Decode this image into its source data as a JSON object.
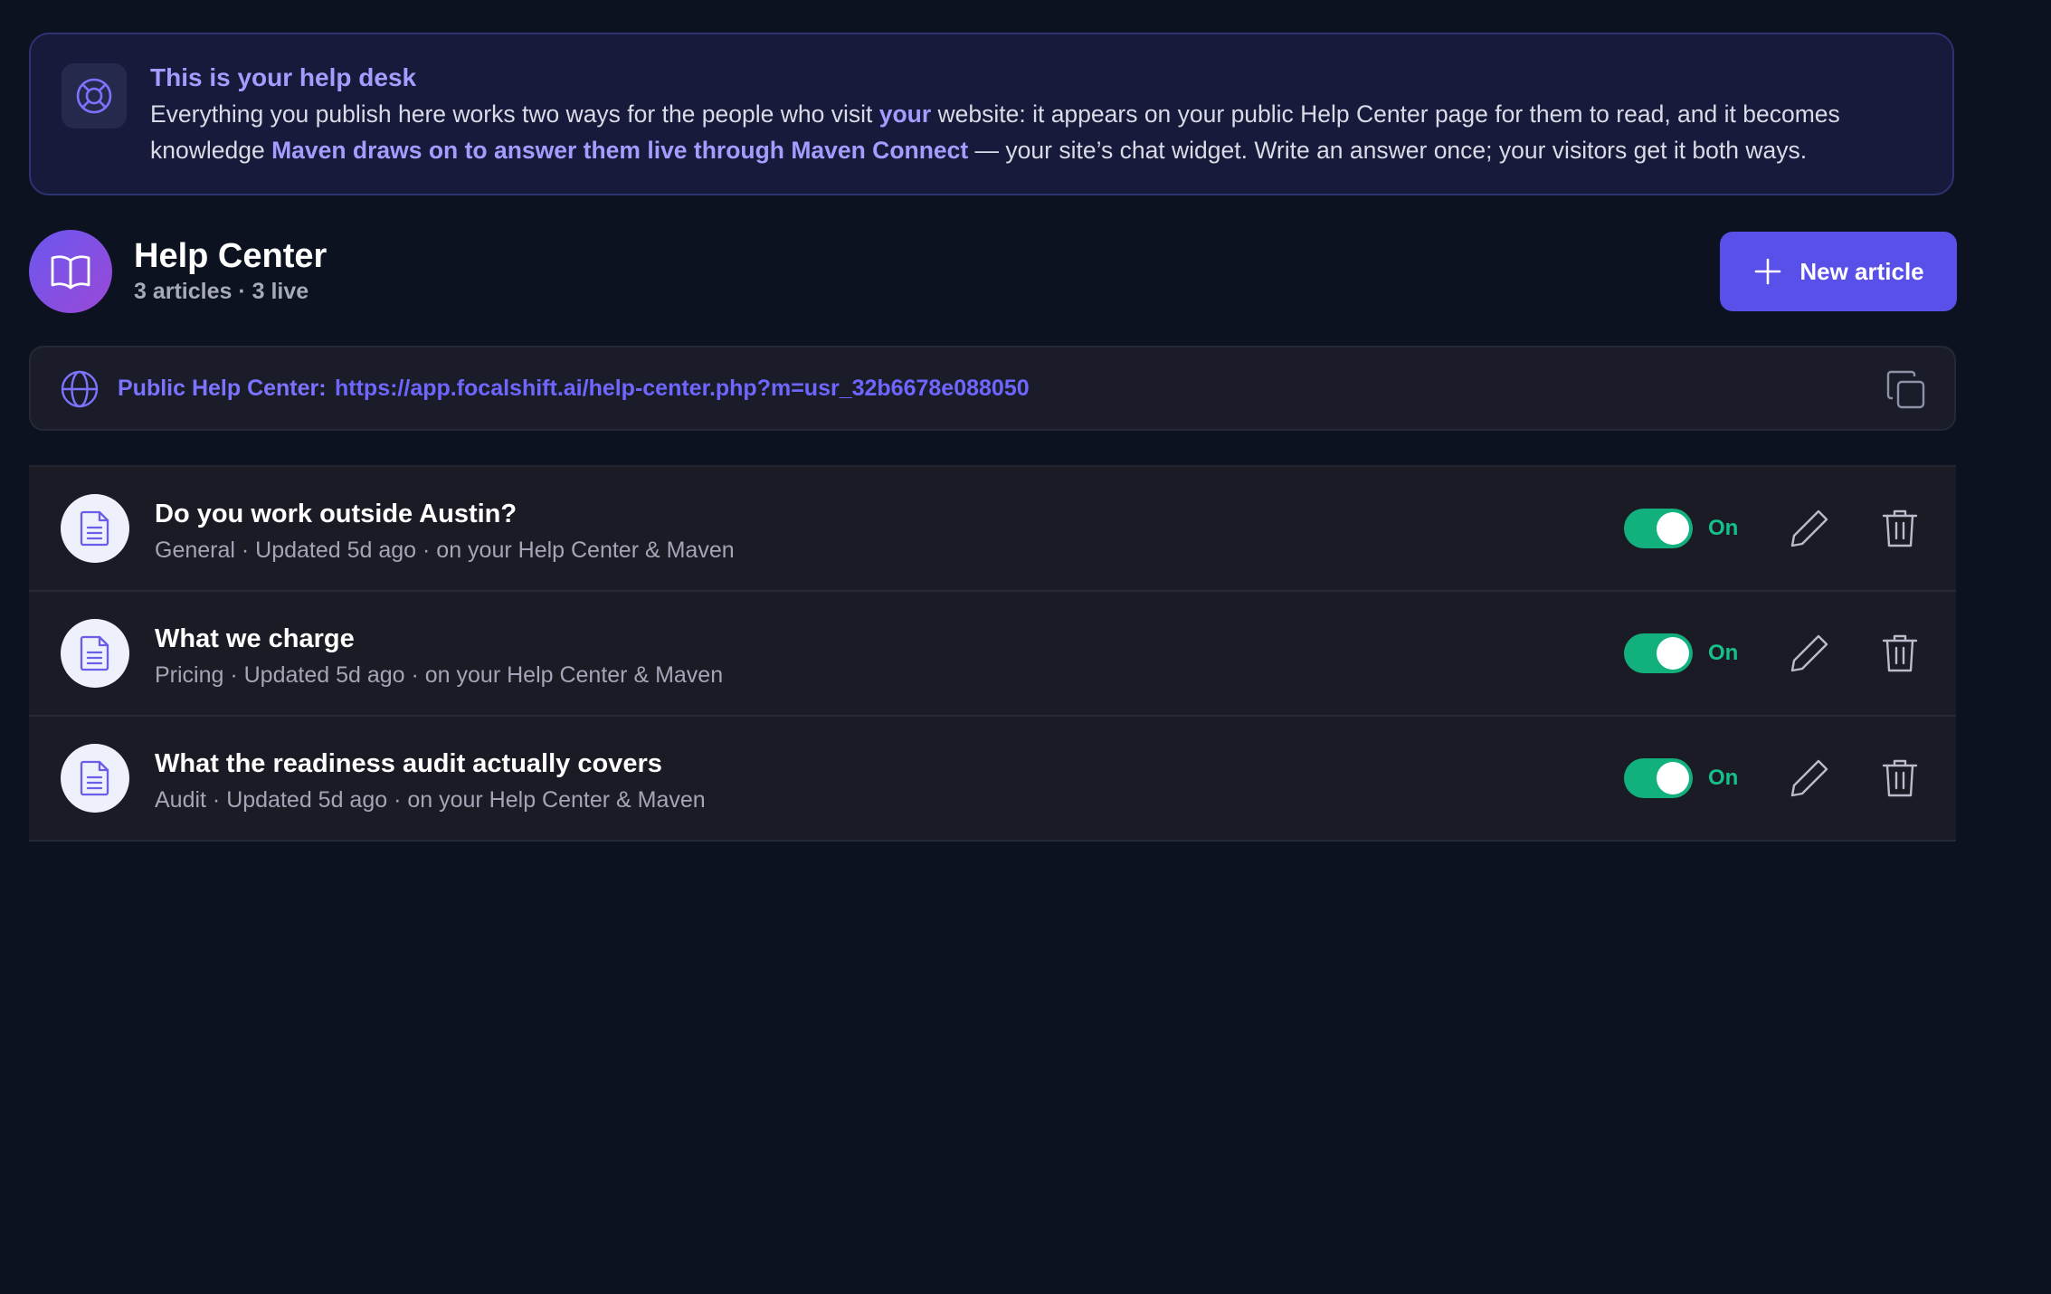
{
  "banner": {
    "icon": "lifebuoy-icon",
    "title": "This is your help desk",
    "body_part1": "Everything you publish here works two ways for the people who visit ",
    "body_hl1": "your",
    "body_part2": " website: it appears on your public Help Center page for them to read, and it becomes knowledge ",
    "body_hl2": "Maven draws on to answer them live through Maven Connect",
    "body_part3": " — your site’s chat widget. Write an answer once; your visitors get it both ways."
  },
  "header": {
    "icon": "open-book-icon",
    "title": "Help Center",
    "subtitle": "3 articles · 3 live",
    "new_article_label": "New article"
  },
  "public_url": {
    "icon": "globe-icon",
    "label": "Public Help Center:",
    "url": "https://app.focalshift.ai/help-center.php?m=usr_32b6678e088050",
    "copy_icon": "copy-icon"
  },
  "articles": [
    {
      "title": "Do you work outside Austin?",
      "meta": "General · Updated 5d ago · on your Help Center & Maven",
      "enabled": true,
      "toggle_label": "On"
    },
    {
      "title": "What we charge",
      "meta": "Pricing · Updated 5d ago · on your Help Center & Maven",
      "enabled": true,
      "toggle_label": "On"
    },
    {
      "title": "What the readiness audit actually covers",
      "meta": "Audit · Updated 5d ago · on your Help Center & Maven",
      "enabled": true,
      "toggle_label": "On"
    }
  ],
  "colors": {
    "background": "#0c1220",
    "accent": "#5850e8",
    "accent_text": "#a59cff",
    "toggle_on": "#12b07c"
  }
}
